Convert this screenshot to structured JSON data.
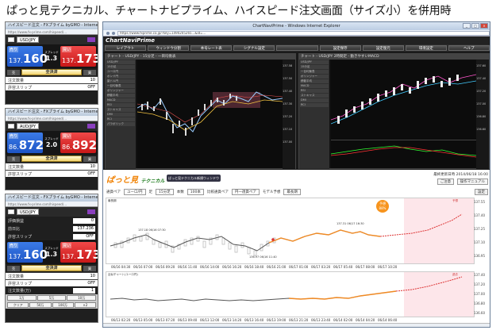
{
  "heading": "ぱっと見テクニカル、チャートナビプライム、ハイスピード注文画面（サイズ小）を併用時",
  "panels": [
    {
      "title": "ハイスピード注文 - FXプライム byGMO - Internet Explorer",
      "addr": "https://www.fx-prime.com/hispeed/... ",
      "pair": "USD/JPY",
      "sell_label": "売り",
      "buy_label": "買い",
      "sell_big": "137.",
      "sell_pips": "160",
      "buy_big": "137.",
      "buy_pips": "173",
      "spread": "1.3",
      "sp_label": "スプレッド",
      "close_label": "全決済",
      "rows": [
        [
          "注文数量",
          "10"
        ],
        [
          "許容スリップ",
          "OFF"
        ]
      ]
    },
    {
      "title": "ハイスピード注文 - FXプライム byGMO - Internet Explorer",
      "addr": "https://www.fx-prime.com/hispeed/... ",
      "pair": "AUD/JPY",
      "sell_label": "売り",
      "buy_label": "買い",
      "sell_big": "86.",
      "sell_pips": "872",
      "buy_big": "86.",
      "buy_pips": "892",
      "spread": "2.0",
      "sp_label": "スプレッド",
      "close_label": "全決済",
      "rows": [
        [
          "注文数量",
          "10"
        ],
        [
          "許容スリップ",
          "OFF"
        ]
      ]
    },
    {
      "title": "ハイスピード注文 - FXプライム byGMO - Internet Explorer",
      "addr": "https://www.fx-prime.com/hispeed/... ",
      "pair": "USD/JPY",
      "sell_label": "売り",
      "buy_label": "買い",
      "sell_big": "137.",
      "sell_pips": "160",
      "buy_big": "137.",
      "buy_pips": "173",
      "spread": "1.3",
      "sp_label": "スプレッド",
      "close_label": "全決済",
      "extra": [
        [
          "評価損益",
          "0"
        ],
        [
          "前日比",
          "137.236"
        ],
        [
          "許容スリップ",
          "OFF"
        ]
      ],
      "rows": [
        [
          "注文数量",
          "10"
        ],
        [
          "許容スリップ",
          "OFF"
        ]
      ],
      "qty_label": "注文数量(万)",
      "qty_value": "1",
      "qty_buttons": [
        "1万",
        "5万",
        "10万"
      ],
      "clr_label": "クリア",
      "clr_buttons": [
        "50万",
        "100万",
        "×2"
      ]
    }
  ],
  "browser": {
    "title": "ChartNaviPrime - Windows Internet Explorer",
    "url": "https://www.fxprime.co.jp/?key=1490205265...&id=...",
    "min": "_",
    "max": "□",
    "close": "×"
  },
  "cnp": {
    "logo": "ChartNaviPrime",
    "menu": [
      "レイアウト",
      "ウィンドウ分割",
      "本号レート表",
      "シグナル設定",
      "",
      "設定保存",
      "設定復元",
      "環境設定",
      "ヘルプ"
    ],
    "chartA_title": "チャート - USD/JPY - 15分足 - 一目均衡表",
    "chartB_title": "チャート - USD/JPY 2時間足 - 動きやすいMACD",
    "left_items": [
      "USD/JPY",
      "15分足",
      "ユーロ円",
      "ポンド円",
      "豪ドル円",
      "一目均衡表",
      "ボリンジャー",
      "移動平均",
      "MACD",
      "RSI",
      "ストキャス",
      "DMI",
      "RCI",
      "パラボリック"
    ],
    "axisA": [
      "137.58",
      "137.50",
      "137.40",
      "137.30",
      "137.20",
      "137.10",
      "137.00"
    ],
    "axisB": [
      "137.60",
      "137.40",
      "137.20",
      "137.00",
      "136.80",
      "136.60"
    ]
  },
  "tech": {
    "logo": "ぱっと見",
    "logo_sub": "テクニカル",
    "open_btn": "ぱっと見テクニカル新規ウィンドウ",
    "ts_label": "最終更新日時",
    "ts_value": "2014/06/18 16:00",
    "tr_buttons": [
      "ご注意",
      "操作マニュアル"
    ],
    "ctl": {
      "pair_label": "通貨ペア",
      "pair": "ユーロ/円",
      "tf_label": "足",
      "tf": "15分足",
      "bars_label": "本数",
      "bars": "100本",
      "compare_label": "比較通貨ペア",
      "compare": "円一週貨ペア",
      "model_label": "モデル予想",
      "model": "最長期",
      "setting": "設定"
    },
    "top_panel": {
      "label": "最長期",
      "badge_top": "予想",
      "badge_value": "88%",
      "pred": "予想",
      "axis": [
        "137.55",
        "137.40",
        "137.25",
        "137.10",
        "136.95"
      ],
      "x_ticks": [
        "06/16 04:30",
        "06/16 07:00",
        "06/16 09:20",
        "06/16 11:40",
        "06/16 14:00",
        "06/16 16:20",
        "06/16 18:40",
        "06/16 21:00",
        "06/17 01:00",
        "06/17 03:20",
        "06/17 05:40",
        "06/17 08:00",
        "06/17 10:20",
        "06/17 12:40",
        "06/17 15:00",
        "06/17 17:20"
      ],
      "notes": [
        "137.18 06/16 07:30",
        "136.97 06/16 11:40",
        "137.31 06/17 16:30"
      ]
    },
    "bottom_panel": {
      "label": "近似チャート(ユーロ円)",
      "pred": "過去",
      "axis": [
        "137.40",
        "137.20",
        "137.00",
        "136.80",
        "136.60"
      ],
      "x_ticks": [
        "06/13 02:20",
        "06/13 05:00",
        "06/13 07:20",
        "06/13 09:40",
        "06/13 12:00",
        "06/13 14:20",
        "06/13 16:40",
        "06/13 19:00",
        "06/13 21:20",
        "06/13 23:40",
        "06/14 02:00",
        "06/14 04:20",
        "06/14 06:40",
        "06/13 10:20",
        "06/13 12:40",
        "06/13 15:00"
      ]
    }
  }
}
